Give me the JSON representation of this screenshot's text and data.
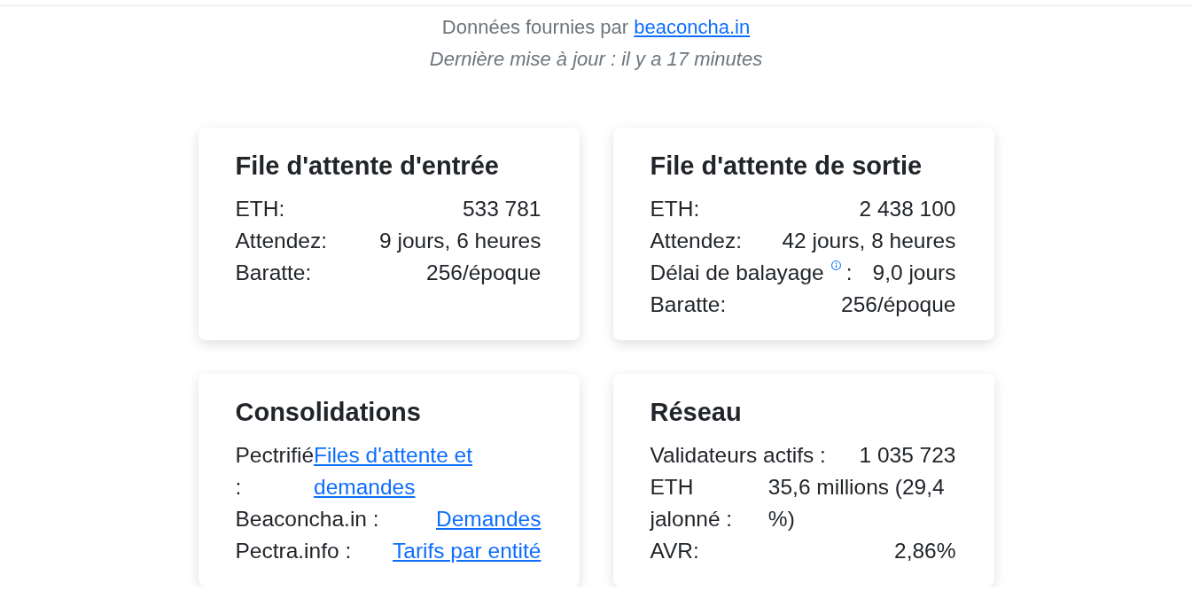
{
  "header": {
    "source_text": "Données fournies par",
    "source_link": "beaconcha.in",
    "updated": "Dernière mise à jour : il y a 17 minutes"
  },
  "cards": [
    {
      "title": "File d'attente d'entrée",
      "rows": [
        {
          "label": "ETH:",
          "value": "533 781",
          "link": false
        },
        {
          "label": "Attendez:",
          "value": "9 jours, 6 heures",
          "link": false
        },
        {
          "label": "Baratte:",
          "value": "256/époque",
          "link": false
        }
      ]
    },
    {
      "title": "File d'attente de sortie",
      "rows": [
        {
          "label": "ETH:",
          "value": "2 438 100",
          "link": false
        },
        {
          "label": "Attendez:",
          "value": "42 jours, 8 heures",
          "link": false
        },
        {
          "label": "Délai de balayage",
          "info": true,
          "label_end": ":",
          "value": "9,0 jours",
          "link": false
        },
        {
          "label": "Baratte:",
          "value": "256/époque",
          "link": false
        }
      ]
    },
    {
      "title": "Consolidations",
      "rows": [
        {
          "label": "Pectrifié :",
          "value": "Files d'attente et demandes",
          "link": true
        },
        {
          "label": "Beaconcha.in :",
          "value": "Demandes",
          "link": true
        },
        {
          "label": "Pectra.info :",
          "value": "Tarifs par entité",
          "link": true
        }
      ]
    },
    {
      "title": "Réseau",
      "rows": [
        {
          "label": "Validateurs actifs :",
          "value": "1 035 723",
          "link": false
        },
        {
          "label": "ETH jalonné :",
          "value": "35,6 millions (29,4 %)",
          "link": false
        },
        {
          "label": "AVR:",
          "value": "2,86%",
          "link": false
        }
      ]
    }
  ]
}
